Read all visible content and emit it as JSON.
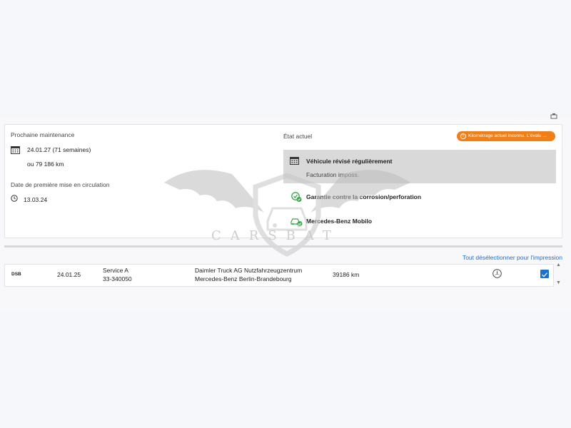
{
  "maintenance": {
    "title": "Prochaine maintenance",
    "date": "24.01.27 (71 semaines)",
    "km": "ou 79 186 km"
  },
  "registration": {
    "title": "Date de première mise en circulation",
    "date": "13.03.24"
  },
  "status": {
    "title": "État actuel",
    "warning": "Kilométrage actuel inconnu. L'évalu ...",
    "items": [
      {
        "label": "Véhicule révisé régulièrement",
        "sub": "Facturation imposs."
      },
      {
        "label": "Garantie contre la corrosion/perforation"
      },
      {
        "label": "Mercedes-Benz Mobilo"
      }
    ]
  },
  "history": {
    "deselect_label": "Tout désélectionner pour l'impression",
    "rows": [
      {
        "type": "DSB",
        "date": "24.01.25",
        "service": "Service A",
        "order": "33-340050",
        "dealer_line1": "Daimler Truck AG Nutzfahrzeugzentrum",
        "dealer_line2": "Mercedes-Benz Berlin-Brandebourg",
        "mileage": "39186 km",
        "checked": true
      }
    ]
  },
  "watermark": {
    "text": "CARSBAT"
  },
  "colors": {
    "accent": "#2670c8",
    "warning": "#f07f17",
    "ok": "#3aa64a",
    "checkbox": "#1d72c9"
  },
  "icons": [
    "calendar-icon",
    "clock-icon",
    "warning-icon",
    "shield-check-icon",
    "car-check-icon",
    "mercedes-star-icon",
    "check-icon"
  ]
}
